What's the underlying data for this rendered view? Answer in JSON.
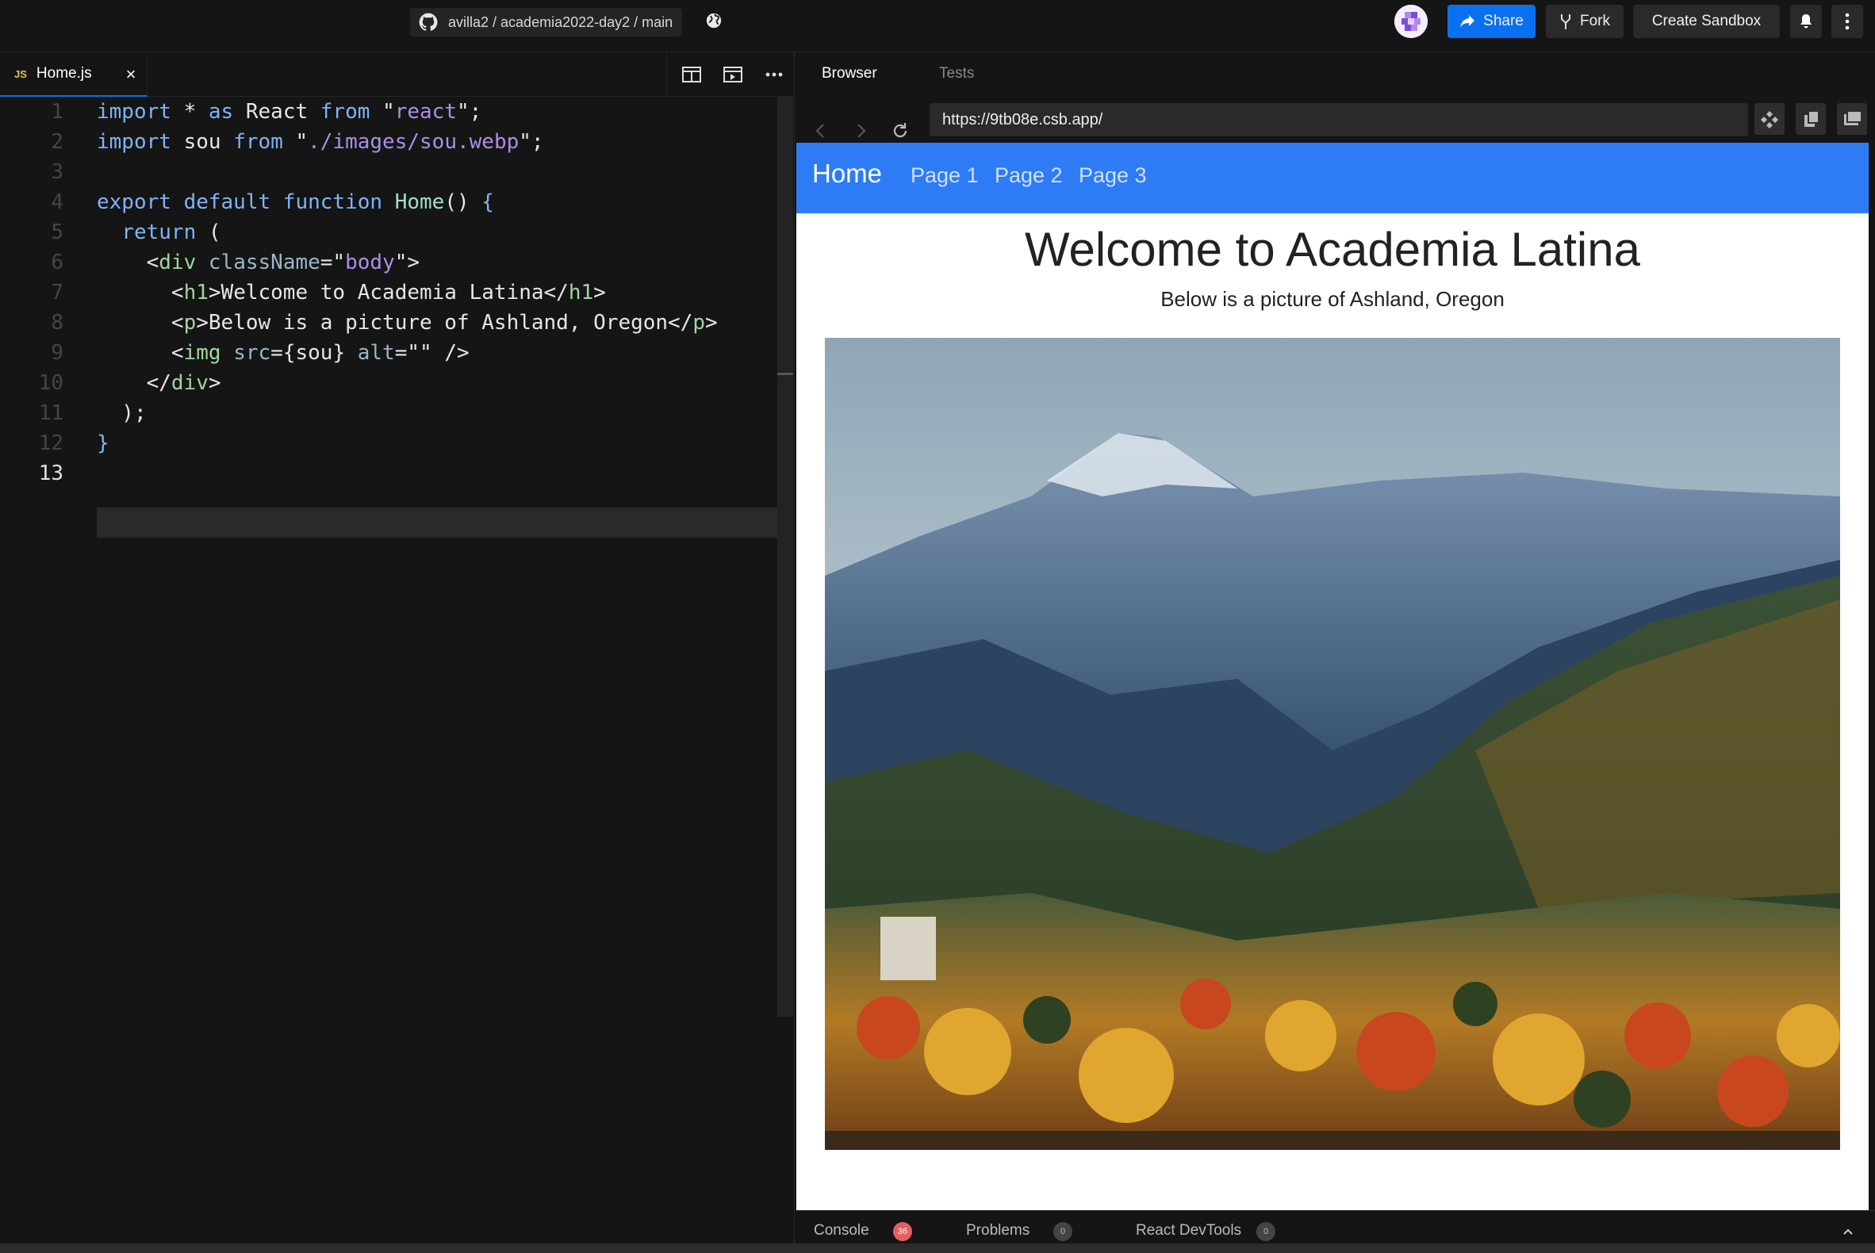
{
  "topbar": {
    "repo_path": "avilla2 / academia2022-day2 / main",
    "share_label": "Share",
    "fork_label": "Fork",
    "create_sandbox_label": "Create Sandbox",
    "accent_color": "#0971f1"
  },
  "editor": {
    "file_tab": {
      "badge": "JS",
      "name": "Home.js",
      "close_glyph": "×"
    },
    "line_numbers": [
      "1",
      "2",
      "3",
      "4",
      "5",
      "6",
      "7",
      "8",
      "9",
      "10",
      "11",
      "12",
      "13"
    ],
    "active_line": 13
  },
  "preview": {
    "tabs": {
      "browser": "Browser",
      "tests": "Tests"
    },
    "url": "https://9tb08e.csb.app/",
    "app": {
      "brand": "Home",
      "links": [
        "Page 1",
        "Page 2",
        "Page 3"
      ],
      "heading": "Welcome to Academia Latina",
      "paragraph": "Below is a picture of Ashland, Oregon",
      "nav_color": "#2d7cf6"
    },
    "console": {
      "console_label": "Console",
      "console_count": "36",
      "problems_label": "Problems",
      "problems_count": "0",
      "devtools_label": "React DevTools",
      "devtools_count": "0"
    }
  }
}
